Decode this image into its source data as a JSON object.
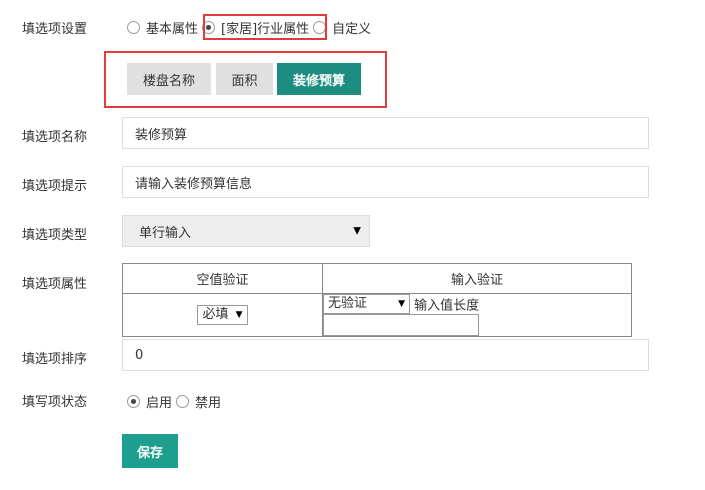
{
  "settings": {
    "label": "填选项设置",
    "options": [
      "基本属性",
      "[家居]行业属性",
      "自定义"
    ],
    "selected": "[家居]行业属性"
  },
  "tabs": [
    {
      "label": "楼盘名称",
      "active": false
    },
    {
      "label": "面积",
      "active": false
    },
    {
      "label": "装修预算",
      "active": true
    }
  ],
  "name_field": {
    "label": "填选项名称",
    "value": "装修预算"
  },
  "hint_field": {
    "label": "填选项提示",
    "value": "请输入装修预算信息"
  },
  "type_field": {
    "label": "填选项类型",
    "value": "单行输入"
  },
  "attr_field": {
    "label": "填选项属性",
    "columns": [
      "空值验证",
      "输入验证"
    ],
    "empty_check": "必填",
    "input_check": "无验证",
    "length_label": "输入值长度",
    "length_value": ""
  },
  "order_field": {
    "label": "填选项排序",
    "value": "0"
  },
  "status_field": {
    "label": "填写项状态",
    "options": [
      "启用",
      "禁用"
    ],
    "selected": "启用"
  },
  "save_label": "保存",
  "colors": {
    "accent": "#1d8d82",
    "highlight": "#e23b3b"
  }
}
